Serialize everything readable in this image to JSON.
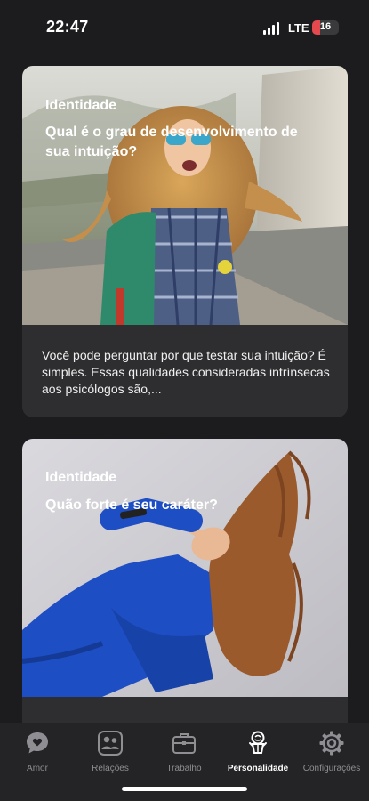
{
  "status_bar": {
    "time": "22:47",
    "network": "LTE",
    "battery": "16"
  },
  "cards": [
    {
      "category": "Identidade",
      "title": "Qual é o grau de desenvolvimento de sua intuição?",
      "description": "Você pode perguntar por que testar sua intuição? É simples. Essas qualidades consideradas intrínsecas aos psicólogos são,..."
    },
    {
      "category": "Identidade",
      "title": "Quão forte é seu caráter?"
    }
  ],
  "tab_bar": {
    "active": "Personalidade",
    "items": [
      {
        "label": "Amor",
        "icon": "heart-chat-icon"
      },
      {
        "label": "Relações",
        "icon": "people-icon"
      },
      {
        "label": "Trabalho",
        "icon": "briefcase-icon"
      },
      {
        "label": "Personalidade",
        "icon": "brain-person-icon"
      },
      {
        "label": "Configurações",
        "icon": "gear-icon"
      }
    ]
  }
}
